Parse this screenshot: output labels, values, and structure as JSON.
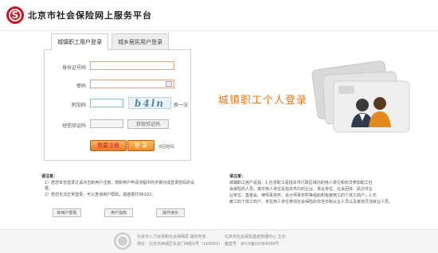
{
  "header": {
    "title": "北京市社会保险网上服务平台",
    "logo_text": "S"
  },
  "tabs": [
    {
      "label": "城镇职工用户登录",
      "active": true
    },
    {
      "label": "城乡居民用户登录",
      "active": false
    }
  ],
  "form": {
    "id_label": "身份证号码",
    "password_label": "密码",
    "captcha_label": "附加码",
    "captcha_image_text": "b4ln",
    "refresh_label": "换一张",
    "sms_label": "短信验证码",
    "sms_button": "获取验证码",
    "register_button": "我要注册",
    "login_button": "登 录",
    "forgot_link": "找回密码"
  },
  "banner": {
    "text": "城镇职工个人登录"
  },
  "notice_left": {
    "heading": "请注意：",
    "lines": [
      "1）若您未曾登录过请点击新用户注册，按新用户申请流程中的步骤完成登录密码的设置。",
      "2）若您无法正常登录，可以查询用户帮助，或者拨打96102。"
    ],
    "buttons": [
      "新用户帮助",
      "用户指南",
      "操作演示"
    ]
  },
  "notice_right": {
    "heading": "请注意：",
    "lines": [
      "城镇职工用户是指：1.在京职工是指本市行政区域内的用人单位和依法参加职工社",
      "会保险的人员，其中用人单位是指本市内的企业、事业单位、社会团体、民办非企",
      "业单位、基金会、律师事务所、会计师事务所等组织和有雇用工的个体工商户；2.无",
      "雇工的个体工商户、未在用人单位参加社会保险的非全日制从业人员以及其他灵活就业人员。"
    ]
  },
  "footer": {
    "line1_left": "北京市人力资源和社会保障局 版权所有",
    "line1_right": "北京市社会保险基金管理中心 主办",
    "line2_left": "地址：北京市西城区永定门西街5号（100050）",
    "line2_right": "备案号：京ICP备05064099号"
  },
  "colors": {
    "brand_red": "#c8161d",
    "accent_orange": "#e67a1e",
    "input_border": "#e0a37e"
  }
}
